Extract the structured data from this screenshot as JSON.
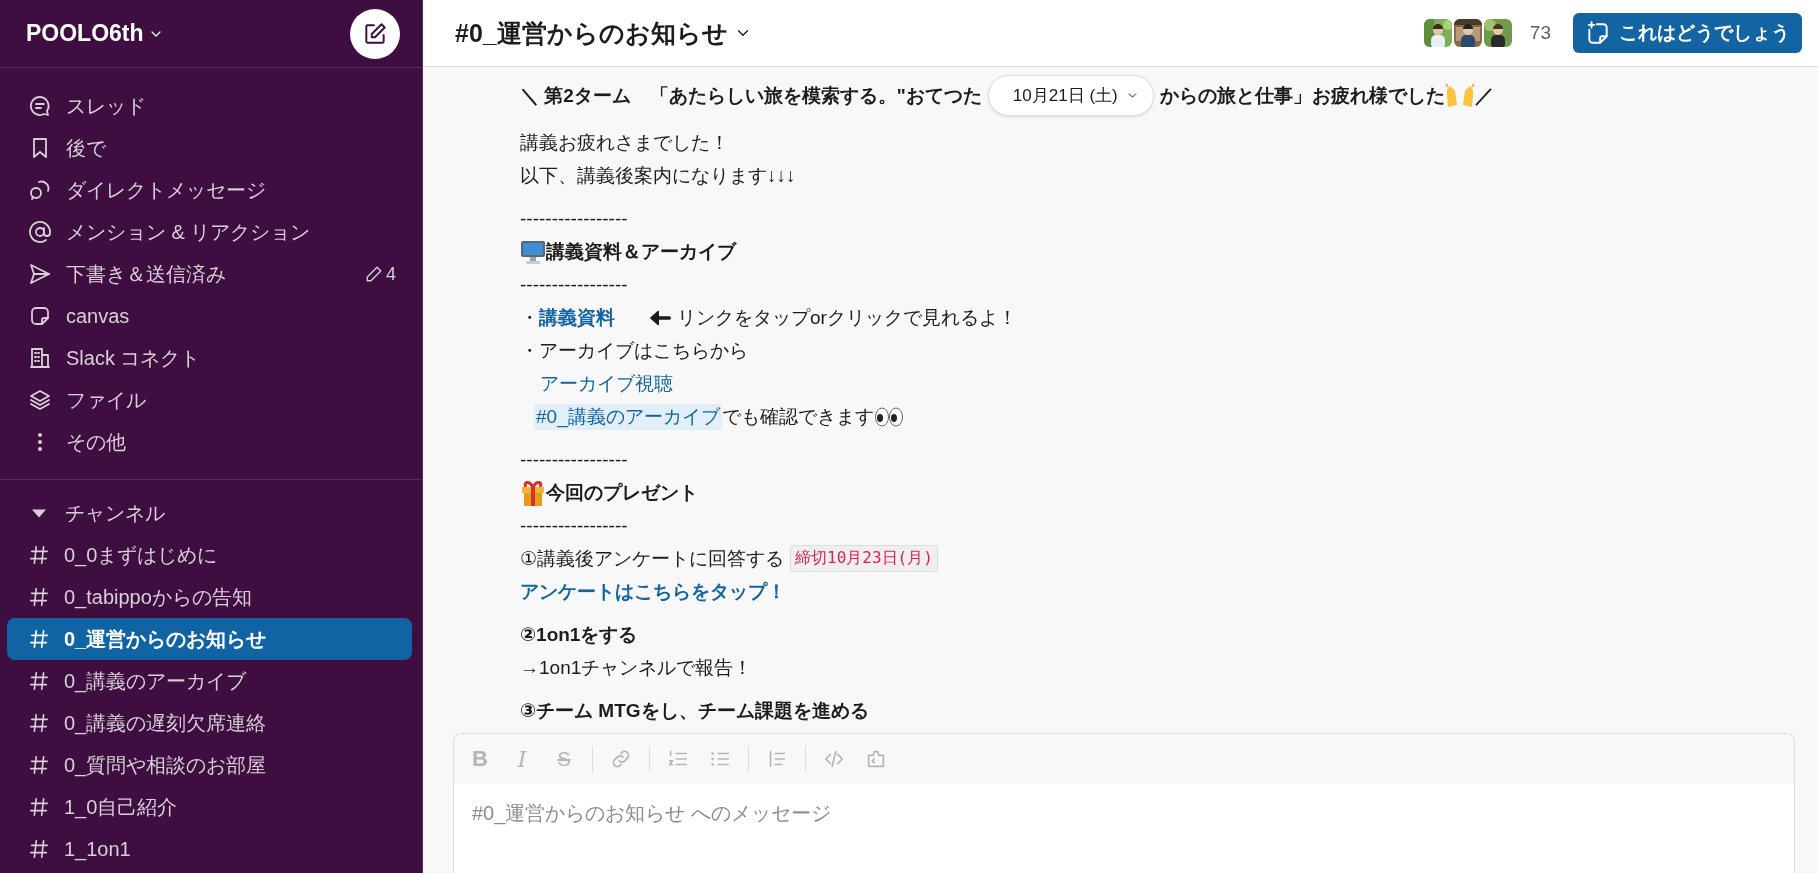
{
  "workspace": {
    "name": "POOLO6th"
  },
  "nav": [
    {
      "kind": "threads",
      "label": "スレッド"
    },
    {
      "kind": "later",
      "label": "後で"
    },
    {
      "kind": "dms",
      "label": "ダイレクトメッセージ"
    },
    {
      "kind": "mentions",
      "label": "メンション & リアクション"
    },
    {
      "kind": "drafts",
      "label": "下書き＆送信済み",
      "badge": "4"
    },
    {
      "kind": "canvas",
      "label": "canvas"
    },
    {
      "kind": "connect",
      "label": "Slack コネクト"
    },
    {
      "kind": "files",
      "label": "ファイル"
    },
    {
      "kind": "more",
      "label": "その他"
    }
  ],
  "channels_section": {
    "label": "チャンネル",
    "expanded": true
  },
  "channels": [
    {
      "name": "0_0まずはじめに",
      "selected": false
    },
    {
      "name": "0_tabippoからの告知",
      "selected": false
    },
    {
      "name": "0_運営からのお知らせ",
      "selected": true
    },
    {
      "name": "0_講義のアーカイブ",
      "selected": false
    },
    {
      "name": "0_講義の遅刻欠席連絡",
      "selected": false
    },
    {
      "name": "0_質問や相談のお部屋",
      "selected": false
    },
    {
      "name": "1_0自己紹介",
      "selected": false
    },
    {
      "name": "1_1on1",
      "selected": false
    }
  ],
  "header": {
    "title": "#0_運営からのお知らせ",
    "member_count": "73",
    "action_button": "これはどうでしょう"
  },
  "date_pill": "10月21日 (土)",
  "message": {
    "blocks": [
      {
        "lines": [
          {
            "kind": "split",
            "left": "＼ 第2ターム　「あたらしい旅を模索する。\"おてつた",
            "right": "からの旅と仕事」お疲れ様でした",
            "tail": "／"
          }
        ]
      },
      {
        "lines": [
          {
            "kind": "text",
            "text": "講義お疲れさまでした！"
          },
          {
            "kind": "text",
            "text": "以下、講義後案内になります↓↓↓"
          }
        ]
      },
      {
        "lines": [
          {
            "kind": "text",
            "text": "-----------------"
          },
          {
            "kind": "monitor_heading",
            "text": "講義資料＆アーカイブ"
          },
          {
            "kind": "text",
            "text": "-----------------"
          },
          {
            "kind": "link_note",
            "bullet": "・",
            "link": "講義資料",
            "note": "リンクをタップorクリックで見れるよ！"
          },
          {
            "kind": "text",
            "text": "・アーカイブはこちらから"
          },
          {
            "kind": "indented_link",
            "text": "アーカイブ視聴"
          },
          {
            "kind": "mention",
            "mention": "#0_講義のアーカイブ",
            "text": "でも確認できます"
          }
        ]
      },
      {
        "lines": [
          {
            "kind": "text",
            "text": "-----------------"
          },
          {
            "kind": "gift_heading",
            "text": "今回のプレゼント"
          },
          {
            "kind": "text",
            "text": "-----------------"
          },
          {
            "kind": "tagged",
            "text": "①講義後アンケートに回答する",
            "tag": "締切10月23日(月)"
          },
          {
            "kind": "bold_link",
            "text": "アンケートはこちらをタップ！"
          }
        ]
      },
      {
        "lines": [
          {
            "kind": "bold",
            "text": "②1on1をする"
          },
          {
            "kind": "text",
            "text": "→1on1チャンネルで報告！"
          }
        ]
      },
      {
        "lines": [
          {
            "kind": "bold",
            "text": "③チーム MTGをし、チーム課題を進める"
          }
        ]
      }
    ]
  },
  "composer": {
    "placeholder": "#0_運営からのお知らせ へのメッセージ",
    "disabled": true,
    "toolbar": [
      [
        {
          "kind": "bold",
          "label": "B"
        },
        {
          "kind": "italic",
          "label": "I"
        },
        {
          "kind": "strike",
          "label": "S"
        }
      ],
      [
        {
          "kind": "link"
        }
      ],
      [
        {
          "kind": "ordered"
        },
        {
          "kind": "bullets"
        }
      ],
      [
        {
          "kind": "quote"
        }
      ],
      [
        {
          "kind": "code"
        },
        {
          "kind": "codeblock"
        }
      ]
    ]
  }
}
